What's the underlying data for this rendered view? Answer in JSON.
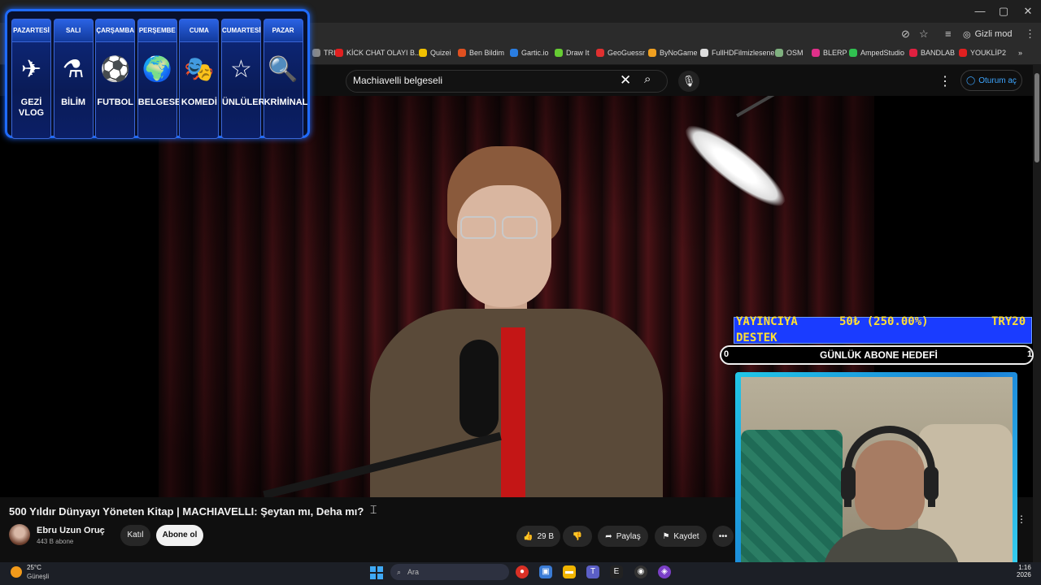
{
  "browser": {
    "window_buttons": {
      "minimize": "—",
      "maximize": "▢",
      "close": "✕"
    },
    "incognito_label": "Gizli mod",
    "bookmarks": [
      {
        "label": "TRIX",
        "color": "#888888"
      },
      {
        "label": "KİCK CHAT OLAYI B...",
        "color": "#e02020"
      },
      {
        "label": "Quizei",
        "color": "#f0c000"
      },
      {
        "label": "Ben Bildim",
        "color": "#e05020"
      },
      {
        "label": "Gartic.io",
        "color": "#2a7de1"
      },
      {
        "label": "Draw It",
        "color": "#66cc33"
      },
      {
        "label": "GeoGuessr",
        "color": "#e03030"
      },
      {
        "label": "ByNoGame",
        "color": "#f0a020"
      },
      {
        "label": "FullHDFilmizlesene",
        "color": "#dddddd"
      },
      {
        "label": "OSM",
        "color": "#7fb07f"
      },
      {
        "label": "BLERP",
        "color": "#e0308a"
      },
      {
        "label": "AmpedStudio",
        "color": "#30c050"
      },
      {
        "label": "BANDLAB",
        "color": "#e02040"
      },
      {
        "label": "YOUKLİP2",
        "color": "#e02020"
      }
    ],
    "bookmarks_more": "»"
  },
  "youtube": {
    "search_value": "Machiavelli belgeseli",
    "clear_icon": "✕",
    "search_icon": "⌕",
    "mic_icon": "🎙",
    "more_icon": "⋮",
    "signin_label": "Oturum aç",
    "video_title": "500 Yıldır Dünyayı Yöneten Kitap | MACHIAVELLI: Şeytan mı, Deha mı?",
    "channel_name": "Ebru Uzun Oruç",
    "verified_icon": "✔",
    "subscribers": "443 B abone",
    "join_label": "Katıl",
    "subscribe_label": "Abone ol",
    "like_count": "29 B",
    "share_label": "Paylaş",
    "save_label": "Kaydet",
    "more_label": "•••"
  },
  "schedule": [
    {
      "day": "PAZARTESİ",
      "icon": "✈",
      "label": "GEZİ VLOG"
    },
    {
      "day": "SALI",
      "icon": "⚗",
      "label": "BİLİM"
    },
    {
      "day": "ÇARŞAMBA",
      "icon": "⚽",
      "label": "FUTBOL"
    },
    {
      "day": "PERŞEMBE",
      "icon": "🌍",
      "label": "BELGESEL"
    },
    {
      "day": "CUMA",
      "icon": "🎭",
      "label": "KOMEDİ"
    },
    {
      "day": "CUMARTESİ",
      "icon": "☆",
      "label": "ÜNLÜLER"
    },
    {
      "day": "PAZAR",
      "icon": "🔍",
      "label": "KRİMİNAL"
    }
  ],
  "stream": {
    "donate_label": "YAYINCIYA DESTEK",
    "donate_amount": "50₺ (250.00%)",
    "donate_currency": "TRY20",
    "goal_label": "GÜNLÜK ABONE HEDEFİ",
    "goal_start": "0",
    "goal_end": "1"
  },
  "taskbar": {
    "temperature": "25°C",
    "weather": "Güneşli",
    "search_placeholder": "Ara",
    "time": "1:16",
    "date": "2026"
  }
}
